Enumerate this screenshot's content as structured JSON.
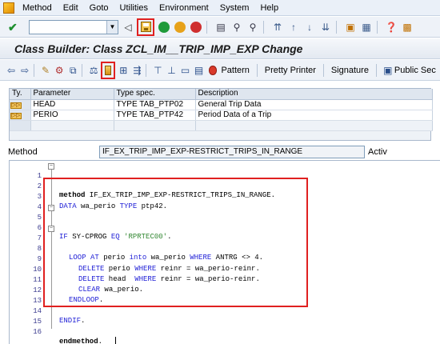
{
  "menubar": {
    "items": [
      "Method",
      "Edit",
      "Goto",
      "Utilities",
      "Environment",
      "System",
      "Help"
    ]
  },
  "stdbar": {
    "command_field_value": ""
  },
  "title": {
    "text": "Class Builder: Class ZCL_IM__TRIP_IMP_EXP Change"
  },
  "apptoolbar": {
    "pattern_label": "Pattern",
    "pretty_printer_label": "Pretty Printer",
    "signature_label": "Signature",
    "public_section_label": "Public Sec"
  },
  "params": {
    "headers": [
      "Ty.",
      "Parameter",
      "Type spec.",
      "Description"
    ],
    "rows": [
      {
        "param": "HEAD",
        "type": "TYPE TAB_PTP02",
        "desc": "General Trip Data"
      },
      {
        "param": "PERIO",
        "type": "TYPE TAB_PTP42",
        "desc": "Period Data of a Trip"
      }
    ]
  },
  "method": {
    "label": "Method",
    "name": "IF_EX_TRIP_IMP_EXP-RESTRICT_TRIPS_IN_RANGE",
    "status": "Activ"
  },
  "code": {
    "line_numbers": [
      "1",
      "2",
      "3",
      "4",
      "5",
      "6",
      "7",
      "8",
      "9",
      "10",
      "11",
      "12",
      "13",
      "14",
      "15",
      "16"
    ],
    "l1_kw": "method",
    "l1_rest": " IF_EX_TRIP_IMP_EXP-RESTRICT_TRIPS_IN_RANGE.",
    "l3_kw1": "DATA",
    "l3_mid": " wa_perio ",
    "l3_kw2": "TYPE",
    "l3_rest": " ptp42.",
    "l5_kw1": "IF",
    "l5_mid": " SY-CPROG ",
    "l5_kw2": "EQ",
    "l5_str": " 'RPRTEC00'",
    "l5_rest": ".",
    "l7_kw1": "LOOP AT",
    "l7_mid1": " perio ",
    "l7_kw2": "into",
    "l7_mid2": " wa_perio ",
    "l7_kw3": "WHERE",
    "l7_rest": " ANTRG <> 4.",
    "l9_kw1": "DELETE",
    "l9_mid1": " perio ",
    "l9_kw2": "WHERE",
    "l9_rest": " reinr = wa_perio-reinr.",
    "l10_kw1": "DELETE",
    "l10_mid1": " head  ",
    "l10_kw2": "WHERE",
    "l10_rest": " reinr = wa_perio-reinr.",
    "l11_kw": "CLEAR",
    "l11_rest": " wa_perio.",
    "l12_kw": "ENDLOOP",
    "l12_rest": ".",
    "l14_kw": "ENDIF",
    "l14_rest": ".",
    "l16_kw": "endmethod",
    "l16_rest": "."
  },
  "colors": {
    "keyword": "#1f1fd6",
    "string": "#338833",
    "highlight_border": "#e02020",
    "toolbar_bg": "#eef2f8"
  }
}
